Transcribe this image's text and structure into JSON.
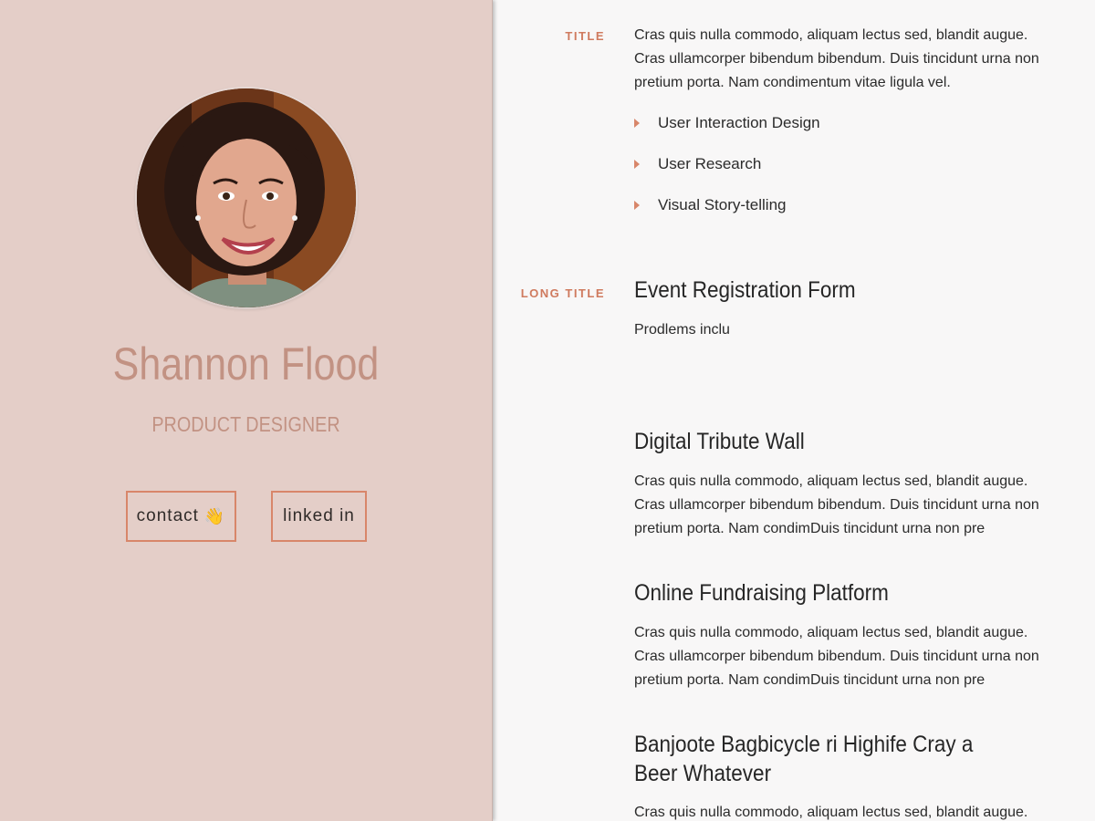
{
  "profile": {
    "name": "Shannon Flood",
    "role": "PRODUCT DESIGNER",
    "contact_label": "contact",
    "contact_emoji": "👋",
    "linkedin_label": "linked in"
  },
  "colors": {
    "accent": "#d8866a",
    "panel_bg": "#e4cec8",
    "name_color": "#c29283"
  },
  "sections": {
    "title": {
      "label": "TITLE",
      "text": "Cras quis nulla commodo, aliquam lectus sed, blandit augue. Cras ullamcorper bibendum bibendum. Duis tincidunt urna non pretium porta. Nam condimentum vitae ligula vel.",
      "skills": [
        "User Interaction Design",
        "User Research",
        "Visual Story-telling"
      ]
    },
    "long_title": {
      "label": "LONG TITLE",
      "heading": "Event Registration Form",
      "text": "Prodlems inclu"
    },
    "projects": [
      {
        "heading": "Digital Tribute Wall",
        "text": "Cras quis nulla commodo, aliquam lectus sed, blandit augue. Cras ullamcorper bibendum bibendum. Duis tincidunt urna non pretium porta. Nam condimDuis tincidunt urna non pre"
      },
      {
        "heading": "Online Fundraising Platform",
        "text": "Cras quis nulla commodo, aliquam lectus sed, blandit augue. Cras ullamcorper bibendum bibendum. Duis tincidunt urna non pretium porta. Nam condimDuis tincidunt urna non pre"
      },
      {
        "heading": "Banjoote Bagbicycle ri Highife Cray a Beer Whatever",
        "text": "Cras quis nulla commodo, aliquam lectus sed, blandit augue."
      }
    ]
  }
}
